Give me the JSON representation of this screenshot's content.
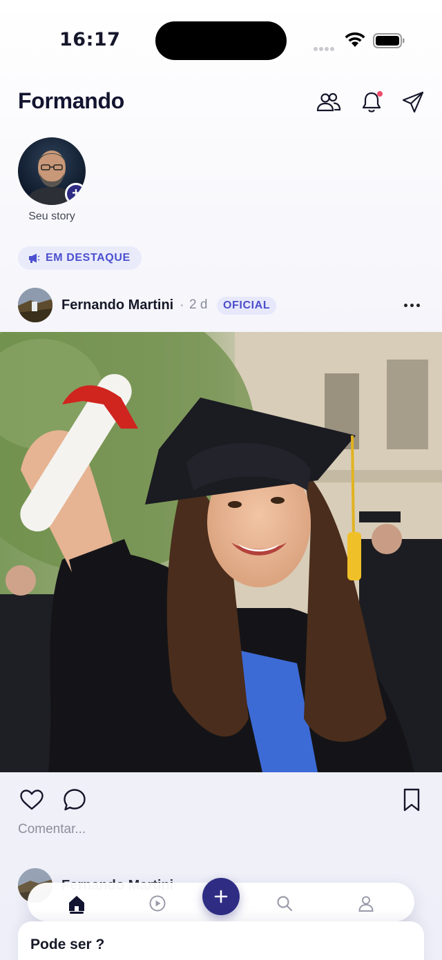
{
  "status_bar": {
    "time": "16:17"
  },
  "header": {
    "title": "Formando",
    "icons": [
      "people-icon",
      "bell-icon",
      "send-icon"
    ]
  },
  "story": {
    "label": "Seu story"
  },
  "featured": {
    "label": "EM DESTAQUE",
    "icon": "megaphone-icon"
  },
  "post": {
    "author": "Fernando Martini",
    "separator": "·",
    "time": "2 d",
    "badge": "OFICIAL",
    "comment_placeholder": "Comentar...",
    "image_alt": "graduate-photo"
  },
  "post2": {
    "author": "Fernando Martini"
  },
  "bottom_nav": {
    "items": [
      "home-icon",
      "play-icon",
      "add-icon",
      "search-icon",
      "profile-icon"
    ],
    "active": "home-icon"
  },
  "sheet": {
    "title": "Pode ser ?"
  },
  "colors": {
    "accent": "#2f2d83",
    "badge_text": "#4a4ec9",
    "badge_bg": "#e7e8fb",
    "notification_dot": "#ef4b6a"
  }
}
